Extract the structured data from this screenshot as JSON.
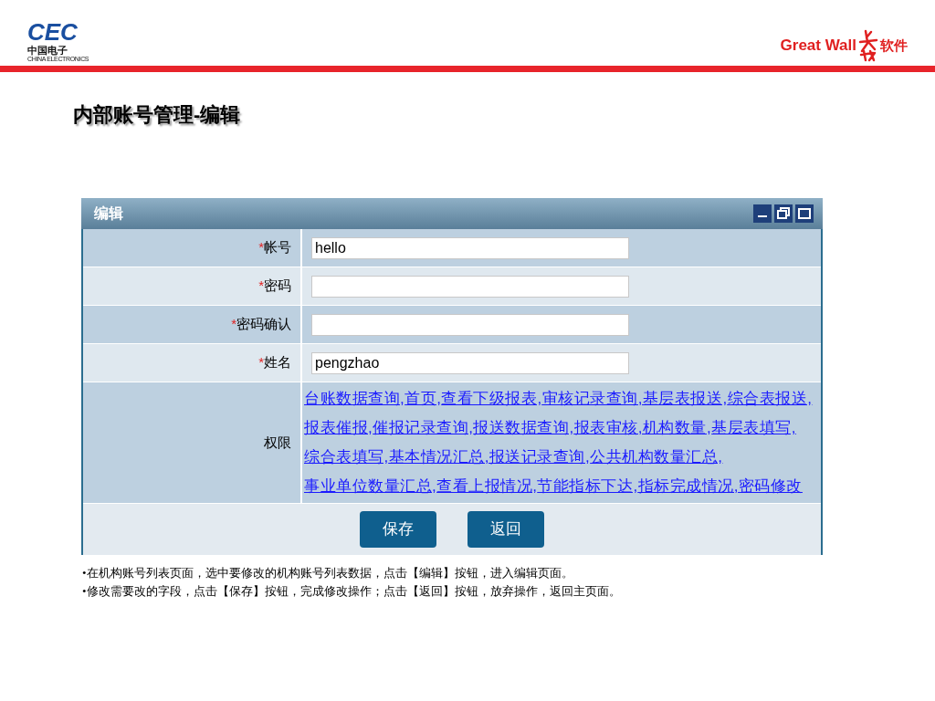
{
  "header": {
    "left_logo": {
      "mark": "CEC",
      "name": "中国电子",
      "subtitle": "CHINA ELECTRONICS"
    },
    "right_logo": {
      "name": "Great Wall",
      "suffix": "软件"
    }
  },
  "slide_title": "内部账号管理-编辑",
  "window": {
    "title": "编辑",
    "fields": [
      {
        "mark": "*",
        "label": "帐号",
        "value": "hello"
      },
      {
        "mark": "*",
        "label": "密码"
      },
      {
        "mark": "*",
        "label": "密码确认"
      },
      {
        "mark": "*",
        "label": "姓名",
        "value": "pengzhao"
      }
    ],
    "permissions": {
      "label": "权限",
      "items": [
        "台账数据查询,",
        "首页,",
        "查看下级报表,",
        "审核记录查询,",
        "基层表报送,",
        "综合表报送,",
        "报表催报,",
        "催报记录查询,",
        "报送数据查询,",
        "报表审核,",
        "机构数量,",
        "基层表填写,",
        "综合表填写,",
        "基本情况汇总,",
        "报送记录查询,",
        "公共机构数量汇总,",
        "事业单位数量汇总,",
        "查看上报情况,",
        "节能指标下达,",
        "指标完成情况,",
        "密码修改"
      ]
    },
    "buttons": [
      "保存",
      "返回"
    ]
  },
  "notes": [
    "•在机构账号列表页面，选中要修改的机构账号列表数据，点击【编辑】按钮，进入编辑页面。",
    "•修改需要改的字段，点击【保存】按钮，完成修改操作；点击【返回】按钮，放弃操作，返回主页面。"
  ]
}
